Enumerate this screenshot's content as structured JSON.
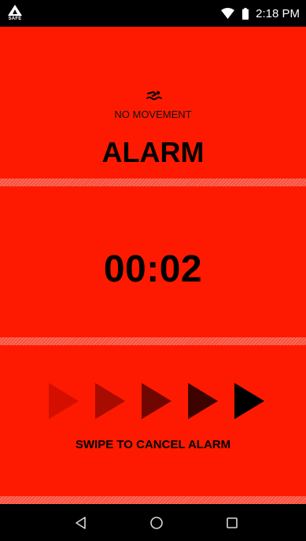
{
  "status_bar": {
    "app_badge": "SAFE",
    "time": "2:18 PM",
    "icons": [
      "safe-logo-icon",
      "wifi-icon",
      "battery-icon"
    ]
  },
  "alarm": {
    "status_icon": "swimmer-icon",
    "status_text": "NO MOVEMENT",
    "title": "ALARM"
  },
  "timer": {
    "value": "00:02"
  },
  "swipe": {
    "label": "SWIPE TO CANCEL ALARM",
    "arrow_icon": "play-arrow-icon",
    "arrow_colors": [
      "#d40f00",
      "#a80b00",
      "#700600",
      "#3c0300",
      "#000000"
    ]
  },
  "nav_bar": {
    "icons": [
      "back-icon",
      "home-icon",
      "recents-icon"
    ]
  },
  "colors": {
    "background": "#fe1a00",
    "bars": "#000000",
    "text": "#000000"
  }
}
